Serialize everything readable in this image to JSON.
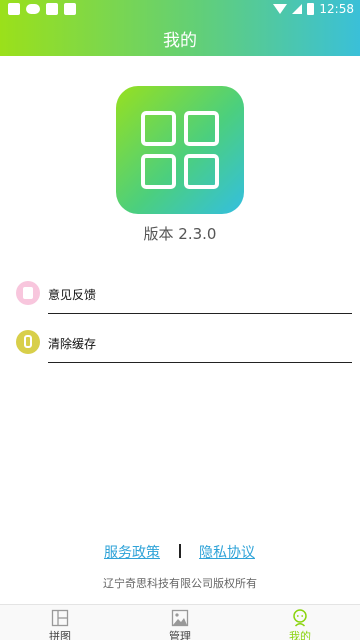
{
  "status_bar": {
    "time": "12:58"
  },
  "header": {
    "title": "我的"
  },
  "app": {
    "version": "版本 2.3.0"
  },
  "menu": [
    {
      "label": "意见反馈",
      "icon": "feedback-icon"
    },
    {
      "label": "清除缓存",
      "icon": "clear-cache-icon"
    }
  ],
  "links": {
    "service": "服务政策",
    "privacy": "隐私协议"
  },
  "copyright": "辽宁奇思科技有限公司版权所有",
  "bottom_nav": [
    {
      "label": "拼图",
      "icon": "grid-icon",
      "active": false
    },
    {
      "label": "管理",
      "icon": "image-icon",
      "active": false
    },
    {
      "label": "我的",
      "icon": "profile-icon",
      "active": true
    }
  ],
  "colors": {
    "gradient_start": "#9be01a",
    "gradient_end": "#3ac0d8",
    "link": "#2fa3d8",
    "active_tab": "#8ad40e"
  }
}
